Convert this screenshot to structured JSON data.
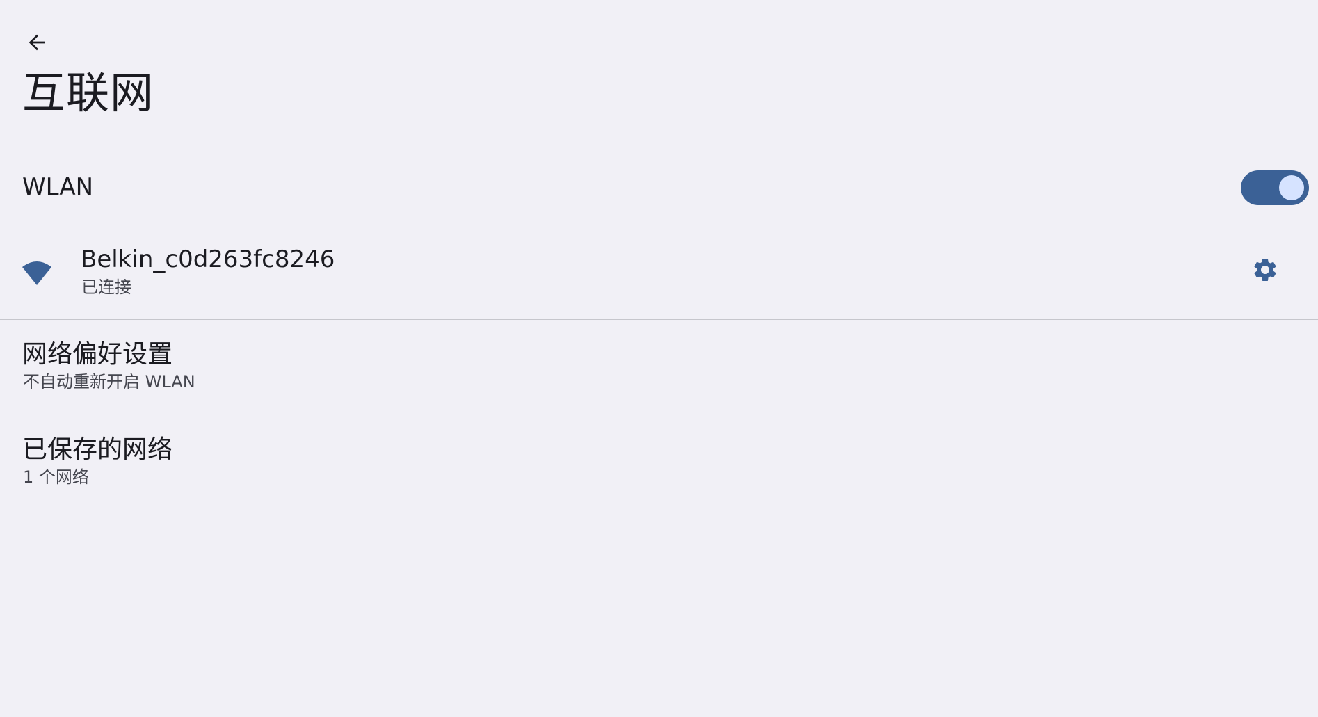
{
  "header": {
    "back_icon": "arrow-left-icon",
    "title": "互联网"
  },
  "wlan": {
    "label": "WLAN",
    "enabled": true,
    "toggle_color": "#3b6196",
    "thumb_color": "#d6e3ff"
  },
  "connected_network": {
    "icon": "wifi-icon",
    "name": "Belkin_c0d263fc8246",
    "status": "已连接",
    "settings_icon": "gear-icon",
    "accent_color": "#3b6196"
  },
  "items": [
    {
      "title": "网络偏好设置",
      "summary": "不自动重新开启 WLAN"
    },
    {
      "title": "已保存的网络",
      "summary": "1 个网络"
    }
  ]
}
